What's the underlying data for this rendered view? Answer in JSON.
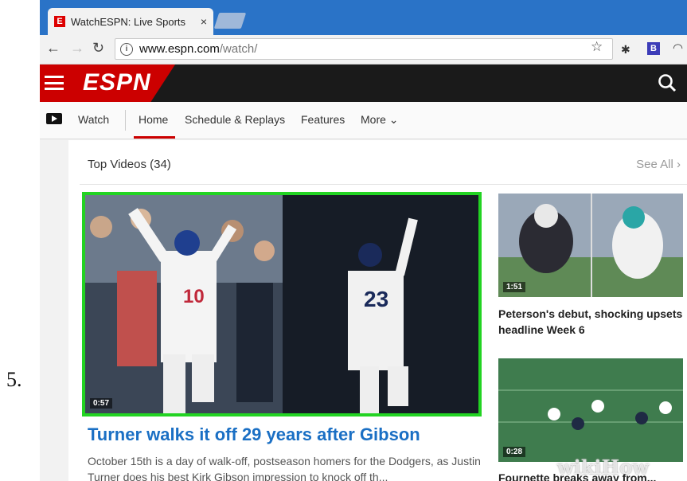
{
  "step_number": "5.",
  "browser": {
    "tab_title": "WatchESPN: Live Sports",
    "tab_close": "×",
    "tab_favicon_letter": "E",
    "url_host": "www.espn.com",
    "url_path": "/watch/",
    "extension_label": "B"
  },
  "espn": {
    "logo": "ESPN",
    "nav": {
      "watch": "Watch",
      "home": "Home",
      "schedule": "Schedule & Replays",
      "features": "Features",
      "more": "More ⌄"
    }
  },
  "top_videos": {
    "title": "Top Videos (34)",
    "see_all": "See All ›"
  },
  "hero": {
    "duration": "0:57",
    "headline": "Turner walks it off 29 years after Gibson",
    "description": "October 15th is a day of walk-off, postseason homers for the Dodgers, as Justin Turner does his best Kirk Gibson impression to knock off th..."
  },
  "side_videos": [
    {
      "duration": "1:51",
      "title": "Peterson's debut, shocking upsets headline Week 6"
    },
    {
      "duration": "0:28",
      "title": "Fournette breaks away from..."
    }
  ],
  "watermark": "wikiHow",
  "colors": {
    "espn_red": "#cc0000",
    "highlight": "#22d322",
    "link_blue": "#1a6fc4",
    "tab_bar": "#2a73c7"
  }
}
